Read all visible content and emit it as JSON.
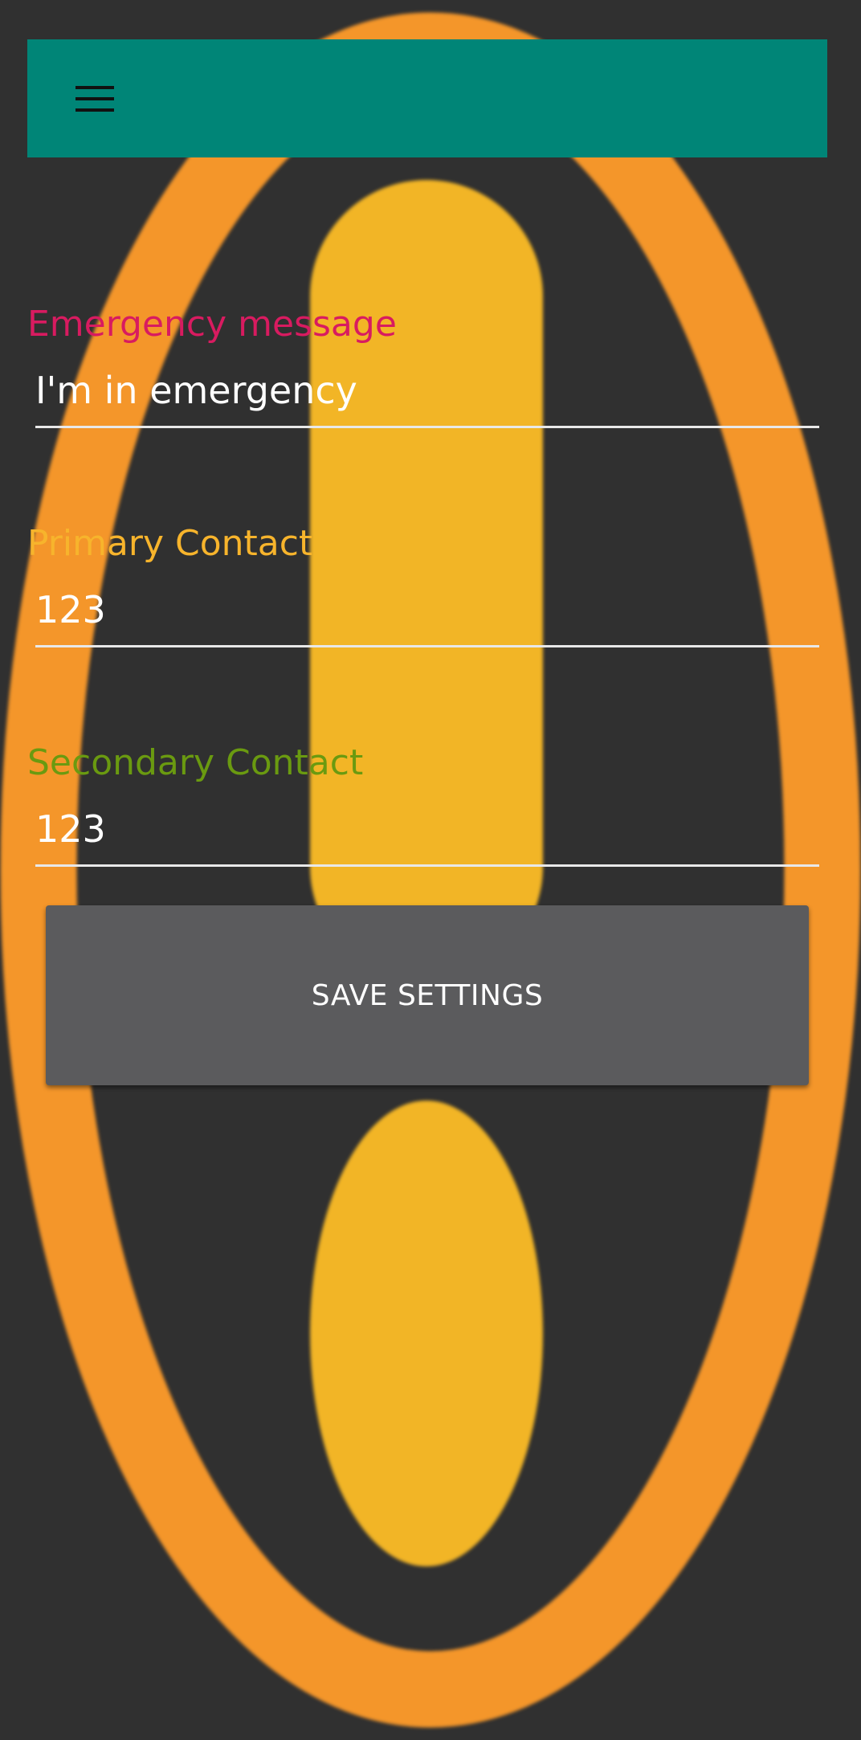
{
  "colors": {
    "toolbar": "#008577",
    "background": "#303030",
    "label_message": "#D81B60",
    "label_primary": "#F7B42C",
    "label_secondary": "#6A9A10",
    "button": "#5B5B5D",
    "background_ring": "#F4962A",
    "background_mark": "#F2B526"
  },
  "toolbar": {
    "menu_icon": "hamburger-menu-icon"
  },
  "background": {
    "icon": "exclamation-warning-icon"
  },
  "form": {
    "message_label": "Emergency message",
    "message_value": "I'm in emergency",
    "primary_label": "Primary Contact",
    "primary_value": "123",
    "secondary_label": "Secondary Contact",
    "secondary_value": "123",
    "save_label": "SAVE SETTINGS"
  }
}
